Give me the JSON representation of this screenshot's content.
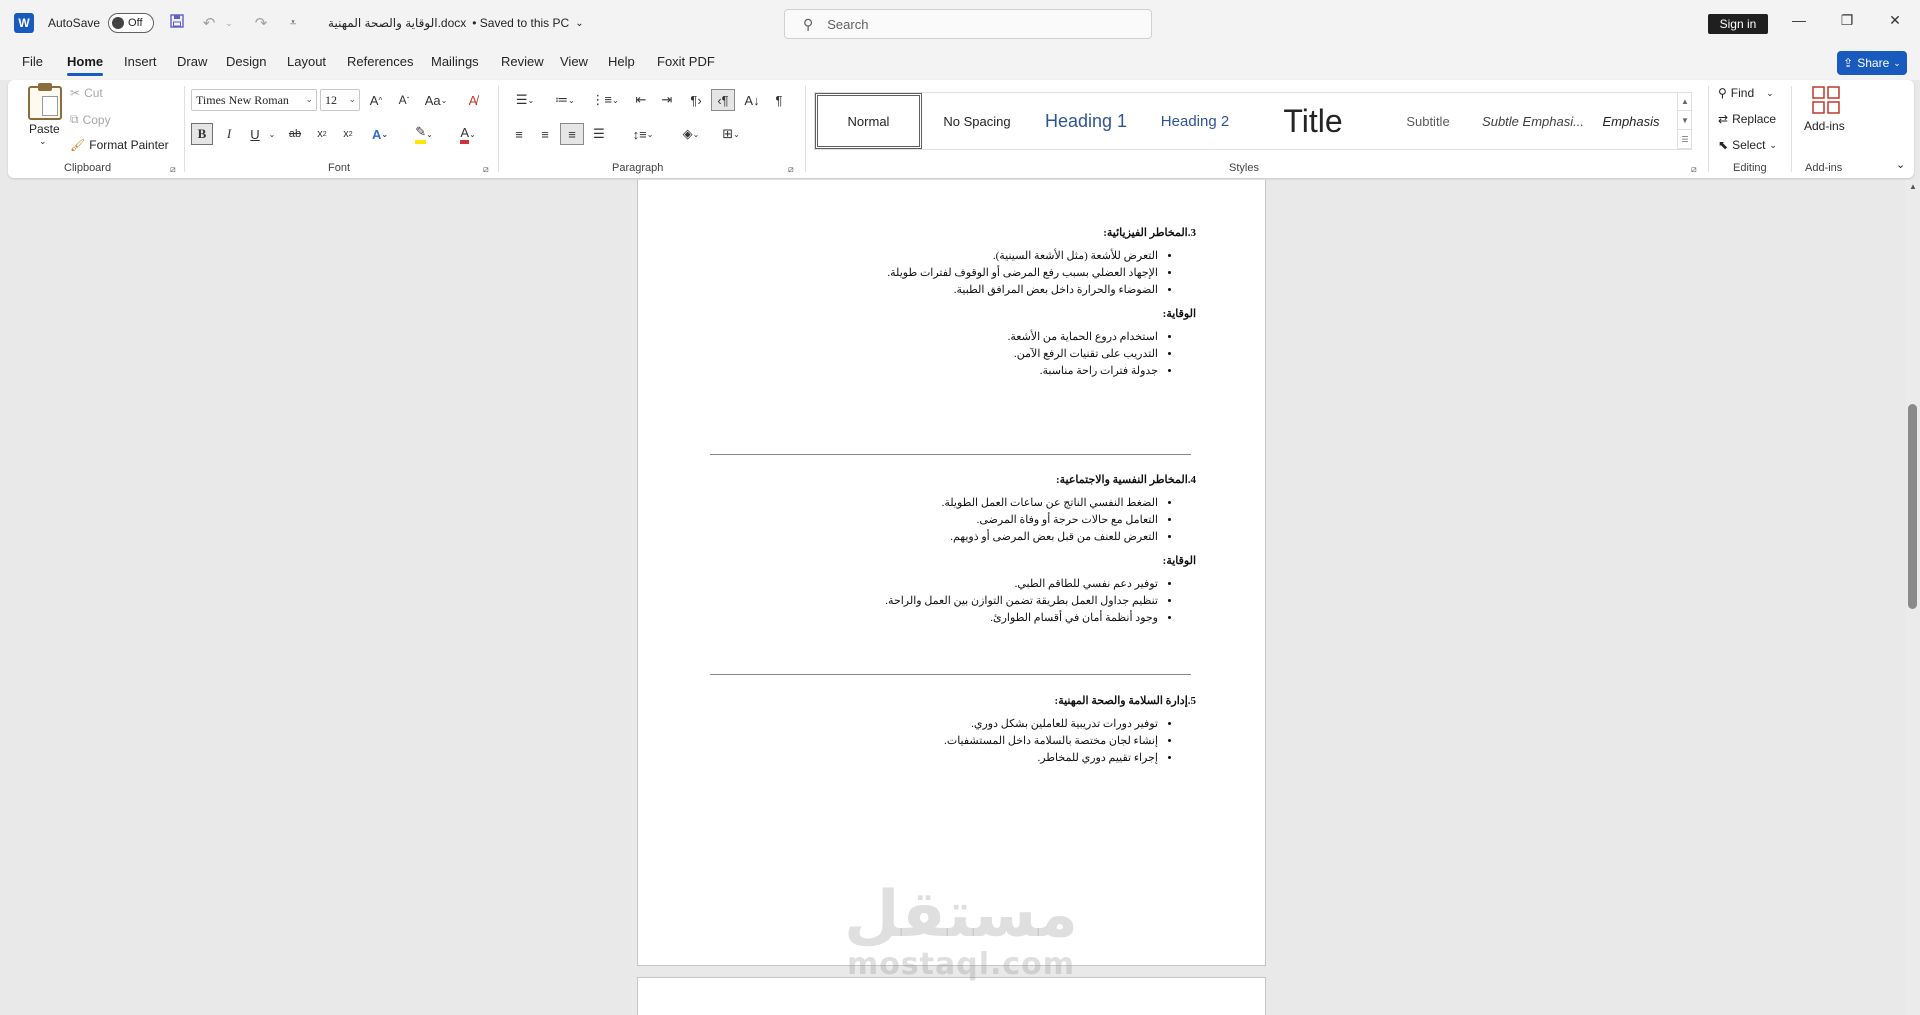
{
  "titlebar": {
    "app_icon": "W",
    "autosave_label": "AutoSave",
    "autosave_state": "Off",
    "doc_title": "الوقاية والصحة المهنية.docx",
    "saved_status": "• Saved to this PC",
    "search_placeholder": "Search",
    "sign_in": "Sign in"
  },
  "menu": {
    "tabs": [
      "File",
      "Home",
      "Insert",
      "Draw",
      "Design",
      "Layout",
      "References",
      "Mailings",
      "Review",
      "View",
      "Help",
      "Foxit PDF"
    ],
    "active_tab": "Home",
    "share": "Share"
  },
  "ribbon": {
    "clipboard": {
      "paste": "Paste",
      "cut": "Cut",
      "copy": "Copy",
      "format_painter": "Format Painter",
      "label": "Clipboard"
    },
    "font": {
      "font_name": "Times New Roman",
      "font_size": "12",
      "label": "Font"
    },
    "paragraph": {
      "label": "Paragraph"
    },
    "styles": {
      "label": "Styles",
      "items": [
        "Normal",
        "No Spacing",
        "Heading 1",
        "Heading 2",
        "Title",
        "Subtitle",
        "Subtle Emphasi...",
        "Emphasis"
      ]
    },
    "editing": {
      "find": "Find",
      "replace": "Replace",
      "select": "Select",
      "label": "Editing"
    },
    "addins": {
      "button": "Add-ins",
      "label": "Add-ins"
    }
  },
  "document": {
    "sections": [
      {
        "heading": "3.المخاطر الفيزيائية:",
        "items": [
          "التعرض للأشعة (مثل الأشعة السينية).",
          "الإجهاد العضلي بسبب رفع المرضى أو الوقوف لفترات طويلة.",
          "الضوضاء والحرارة داخل بعض المرافق الطبية."
        ],
        "prevention_heading": "الوقاية:",
        "prevention_items": [
          "استخدام دروع الحماية من الأشعة.",
          "التدريب على تقنيات الرفع الآمن.",
          "جدولة فترات راحة مناسبة."
        ]
      },
      {
        "heading": "4.المخاطر النفسية والاجتماعية:",
        "items": [
          "الضغط النفسي الناتج عن ساعات العمل الطويلة.",
          "التعامل مع حالات حرجة أو وفاة المرضى.",
          "التعرض للعنف من قبل بعض المرضى أو ذويهم."
        ],
        "prevention_heading": "الوقاية:",
        "prevention_items": [
          "توفير دعم نفسي للطاقم الطبي.",
          "تنظيم جداول العمل بطريقة تضمن التوازن بين العمل والراحة.",
          "وجود أنظمة أمان في أقسام الطوارئ."
        ]
      },
      {
        "heading": "5.إدارة السلامة والصحة المهنية:",
        "items": [
          "توفير دورات تدريبية للعاملين بشكل دوري.",
          "إنشاء لجان مختصة بالسلامة داخل المستشفيات.",
          "إجراء تقييم دوري للمخاطر."
        ]
      }
    ],
    "watermark_ar": "مستقل",
    "watermark_lat": "mostaql.com"
  }
}
